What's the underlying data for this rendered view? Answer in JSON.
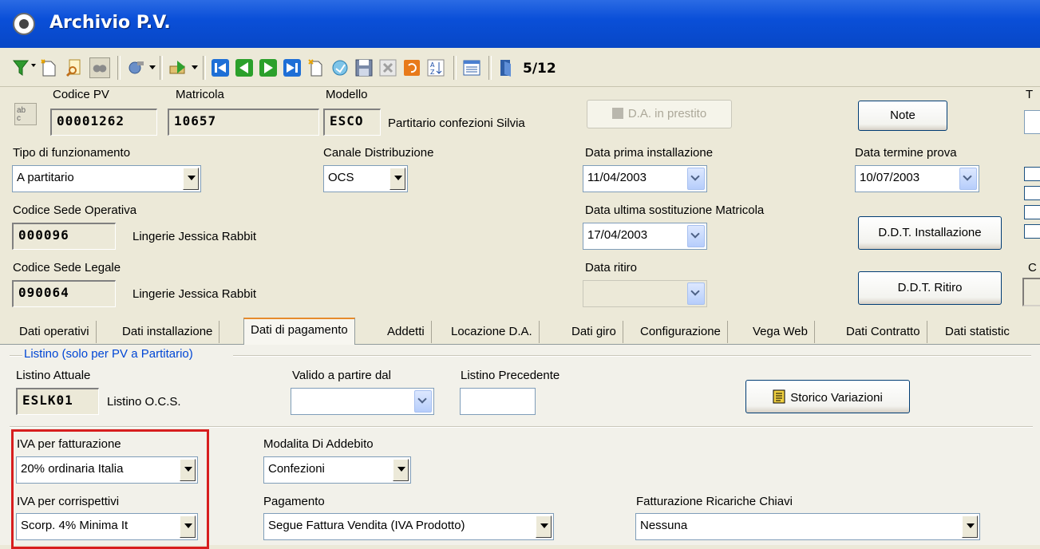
{
  "window": {
    "title": "Archivio P.V."
  },
  "toolbar": {
    "record_position": "5/12"
  },
  "header": {
    "codice_pv": {
      "label": "Codice PV",
      "value": "00001262"
    },
    "matricola": {
      "label": "Matricola",
      "value": "10657"
    },
    "modello": {
      "label": "Modello",
      "code": "ESCO",
      "description": "Partitario confezioni Silvia"
    },
    "da_prestito_button": "D.A. in prestito",
    "note_button": "Note",
    "tipo_funzionamento": {
      "label": "Tipo di funzionamento",
      "value": "A partitario"
    },
    "canale_distribuzione": {
      "label": "Canale Distribuzione",
      "value": "OCS"
    },
    "data_prima_installazione": {
      "label": "Data prima installazione",
      "value": "11/04/2003"
    },
    "data_termine_prova": {
      "label": "Data termine prova",
      "value": "10/07/2003"
    },
    "codice_sede_operativa": {
      "label": "Codice Sede Operativa",
      "code": "000096",
      "description": "Lingerie Jessica Rabbit"
    },
    "data_ultima_sostituzione": {
      "label": "Data ultima sostituzione Matricola",
      "value": "17/04/2003"
    },
    "ddt_installazione_button": "D.D.T. Installazione",
    "codice_sede_legale": {
      "label": "Codice Sede Legale",
      "code": "090064",
      "description": "Lingerie Jessica Rabbit"
    },
    "data_ritiro": {
      "label": "Data ritiro",
      "value": ""
    },
    "ddt_ritiro_button": "D.D.T. Ritiro",
    "cut_label_t": "T",
    "cut_label_c": "C"
  },
  "tabs": [
    {
      "label": "Dati operativi"
    },
    {
      "label": "Dati installazione"
    },
    {
      "label": "Dati di pagamento"
    },
    {
      "label": "Addetti"
    },
    {
      "label": "Locazione D.A."
    },
    {
      "label": "Dati giro"
    },
    {
      "label": "Configurazione"
    },
    {
      "label": "Vega Web"
    },
    {
      "label": "Dati Contratto"
    },
    {
      "label": "Dati statistic"
    }
  ],
  "payment": {
    "group_title": "Listino (solo per PV a Partitario)",
    "listino_attuale": {
      "label": "Listino Attuale",
      "code": "ESLK01",
      "description": "Listino O.C.S."
    },
    "valido_dal": {
      "label": "Valido a partire dal",
      "value": ""
    },
    "listino_precedente": {
      "label": "Listino Precedente",
      "value": ""
    },
    "storico_button": "Storico Variazioni",
    "iva_fatturazione": {
      "label": "IVA per fatturazione",
      "value": "20% ordinaria Italia"
    },
    "modalita_addebito": {
      "label": "Modalita Di Addebito",
      "value": "Confezioni"
    },
    "iva_corrispettivi": {
      "label": "IVA per corrispettivi",
      "value": "Scorp. 4% Minima It"
    },
    "pagamento": {
      "label": "Pagamento",
      "value": "Segue Fattura Vendita (IVA Prodotto)"
    },
    "fatturazione_ricariche": {
      "label": "Fatturazione Ricariche Chiavi",
      "value": "Nessuna"
    }
  }
}
